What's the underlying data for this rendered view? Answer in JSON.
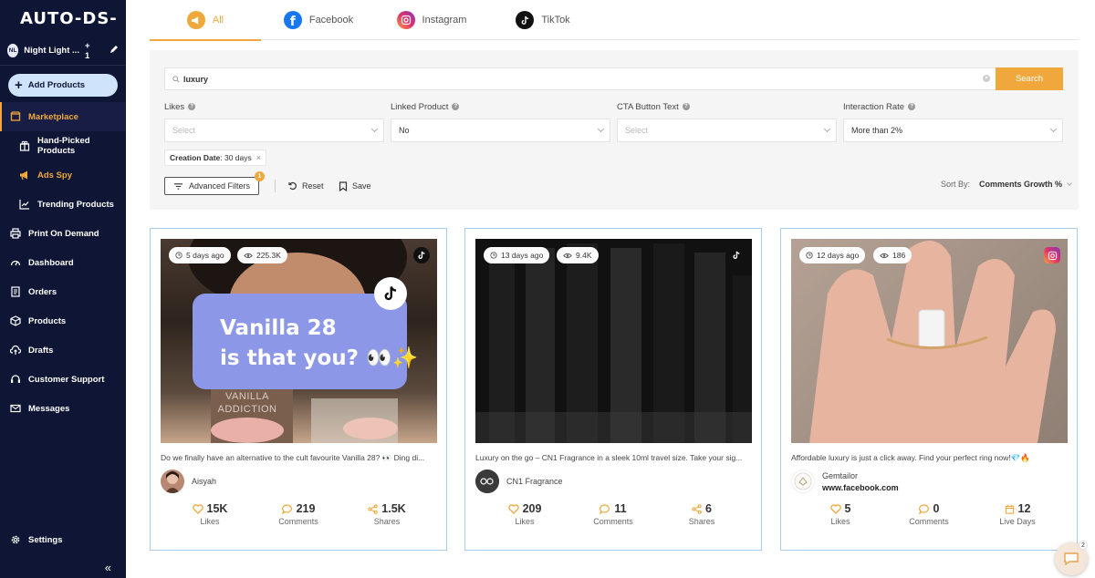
{
  "app": {
    "logo": "AUTO-DS-"
  },
  "store": {
    "initials": "NL",
    "name": "Night Light ...",
    "extra": "+ 1"
  },
  "sidebar": {
    "add_products": "Add Products",
    "items": [
      {
        "label": "Marketplace",
        "icon": "store-icon"
      },
      {
        "label": "Hand-Picked Products",
        "icon": "gift-icon"
      },
      {
        "label": "Ads Spy",
        "icon": "megaphone-icon"
      },
      {
        "label": "Trending Products",
        "icon": "trend-icon"
      },
      {
        "label": "Print On Demand",
        "icon": "print-icon"
      },
      {
        "label": "Dashboard",
        "icon": "dashboard-icon"
      },
      {
        "label": "Orders",
        "icon": "orders-icon"
      },
      {
        "label": "Products",
        "icon": "box-icon"
      },
      {
        "label": "Drafts",
        "icon": "cloud-upload-icon"
      },
      {
        "label": "Customer Support",
        "icon": "headset-icon"
      },
      {
        "label": "Messages",
        "icon": "mail-icon"
      }
    ],
    "settings": "Settings",
    "collapse": "«"
  },
  "tabs": [
    {
      "label": "All",
      "active": true
    },
    {
      "label": "Facebook"
    },
    {
      "label": "Instagram"
    },
    {
      "label": "TikTok"
    }
  ],
  "filters": {
    "search_value": "luxury",
    "search_button": "Search",
    "likes": {
      "label": "Likes",
      "value": "Select"
    },
    "linked_product": {
      "label": "Linked Product",
      "value": "No"
    },
    "cta_button_text": {
      "label": "CTA Button Text",
      "value": "Select"
    },
    "interaction_rate": {
      "label": "Interaction Rate",
      "value": "More than 2%"
    },
    "chip": {
      "key": "Creation Date",
      "value": ": 30 days"
    },
    "advanced": "Advanced Filters",
    "advanced_count": "1",
    "reset": "Reset",
    "save": "Save",
    "sort_label": "Sort By:",
    "sort_value": "Comments Growth %"
  },
  "cards": [
    {
      "age": "5 days ago",
      "views": "225.3K",
      "platform": "tiktok",
      "overlay_line1": "Vanilla 28",
      "overlay_line2": "is that you? 👀✨",
      "bottle_text1": "VANILLA",
      "bottle_text2": "ADDICTION",
      "caption": "Do we finally have an alternative to the cult favourite Vanilla 28? 👀 Ding di...",
      "author": "Aisyah",
      "link": "",
      "stats": [
        {
          "value": "15K",
          "label": "Likes"
        },
        {
          "value": "219",
          "label": "Comments"
        },
        {
          "value": "1.5K",
          "label": "Shares"
        }
      ]
    },
    {
      "age": "13 days ago",
      "views": "9.4K",
      "platform": "tiktok",
      "caption": "Luxury on the go – CN1 Fragrance in a sleek 10ml travel size. Take your sig...",
      "author": "CN1 Fragrance",
      "link": "",
      "stats": [
        {
          "value": "209",
          "label": "Likes"
        },
        {
          "value": "11",
          "label": "Comments"
        },
        {
          "value": "6",
          "label": "Shares"
        }
      ]
    },
    {
      "age": "12 days ago",
      "views": "186",
      "platform": "instagram",
      "caption": "Affordable luxury is just a click away. Find your perfect ring now!💎🔥",
      "author": "Gemtailor",
      "link": "www.facebook.com",
      "stats": [
        {
          "value": "5",
          "label": "Likes"
        },
        {
          "value": "0",
          "label": "Comments"
        },
        {
          "value": "12",
          "label": "Live Days"
        }
      ]
    }
  ],
  "chat": {
    "count": "2"
  },
  "colors": {
    "accent": "#f0a83c",
    "sidebar": "#0f1535",
    "card_border": "#a8cdea"
  }
}
